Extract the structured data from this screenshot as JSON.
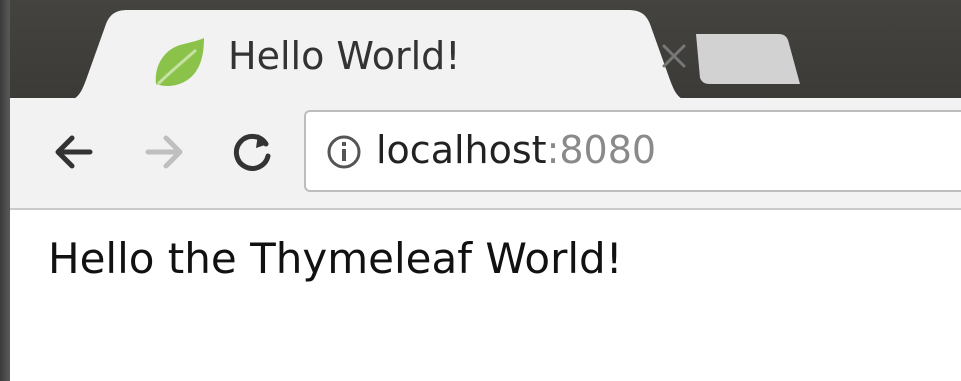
{
  "browser": {
    "tab": {
      "title": "Hello World!",
      "favicon": "spring-leaf-icon",
      "close_icon": "close-icon"
    },
    "toolbar": {
      "back_icon": "arrow-left-icon",
      "forward_icon": "arrow-right-icon",
      "reload_icon": "reload-icon",
      "site_info_icon": "info-icon"
    },
    "address": {
      "host": "localhost",
      "port": ":8080"
    }
  },
  "page": {
    "text": "Hello the Thymeleaf World!"
  },
  "colors": {
    "tabstrip": "#3d3c39",
    "toolbar": "#f2f2f2",
    "favicon_green": "#8bc34a",
    "url_port": "#8a8a8a"
  }
}
